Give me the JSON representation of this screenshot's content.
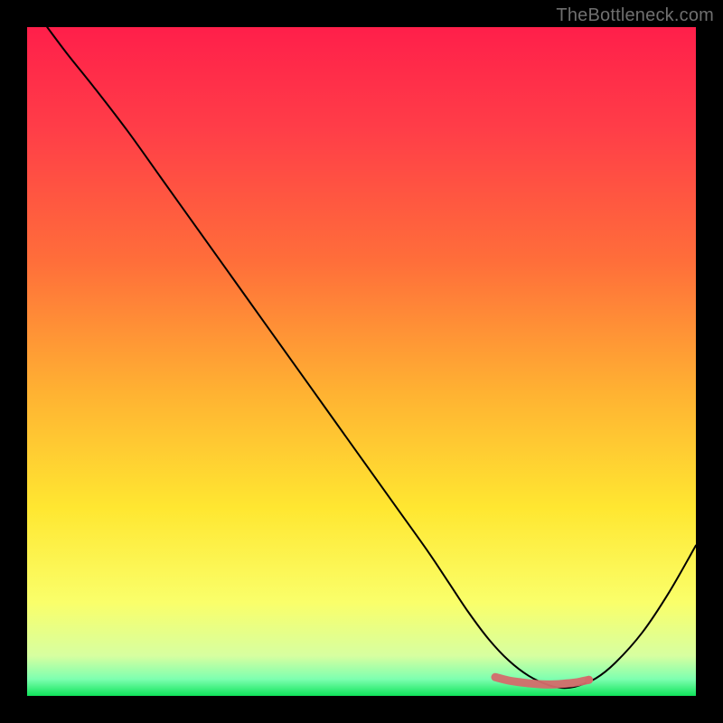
{
  "attribution": "TheBottleneck.com",
  "gradient_stops": [
    {
      "offset": 0.0,
      "color": "#ff1f4a"
    },
    {
      "offset": 0.15,
      "color": "#ff3d48"
    },
    {
      "offset": 0.35,
      "color": "#ff6e3a"
    },
    {
      "offset": 0.55,
      "color": "#ffb332"
    },
    {
      "offset": 0.72,
      "color": "#ffe731"
    },
    {
      "offset": 0.86,
      "color": "#faff6a"
    },
    {
      "offset": 0.94,
      "color": "#d7ffa0"
    },
    {
      "offset": 0.975,
      "color": "#7dffb0"
    },
    {
      "offset": 1.0,
      "color": "#10e45b"
    }
  ],
  "curve_color": "#000000",
  "curve_width": 2,
  "minimum_band_color": "#d46b6b",
  "minimum_band_opacity": 0.95,
  "chart_data": {
    "type": "line",
    "title": "",
    "xlabel": "",
    "ylabel": "",
    "xlim": [
      0,
      100
    ],
    "ylim": [
      0,
      100
    ],
    "series": [
      {
        "name": "curve",
        "x": [
          3,
          6,
          10,
          15,
          20,
          25,
          30,
          35,
          40,
          45,
          50,
          55,
          60,
          63,
          66,
          69,
          72,
          75,
          78,
          80,
          82,
          85,
          88,
          92,
          96,
          100
        ],
        "y": [
          100,
          96,
          91,
          84.5,
          77.5,
          70.5,
          63.5,
          56.5,
          49.5,
          42.5,
          35.5,
          28.5,
          21.5,
          17,
          12.5,
          8.5,
          5.3,
          3.0,
          1.6,
          1.2,
          1.4,
          2.6,
          5.0,
          9.5,
          15.5,
          22.5
        ]
      },
      {
        "name": "minimum-band",
        "x": [
          70,
          72,
          74,
          76,
          78,
          80,
          82,
          84
        ],
        "y": [
          2.8,
          2.3,
          2.0,
          1.8,
          1.7,
          1.8,
          2.0,
          2.4
        ]
      }
    ],
    "annotations": [
      {
        "name": "minimum-endpoint",
        "x": 84,
        "y": 2.4
      }
    ]
  }
}
